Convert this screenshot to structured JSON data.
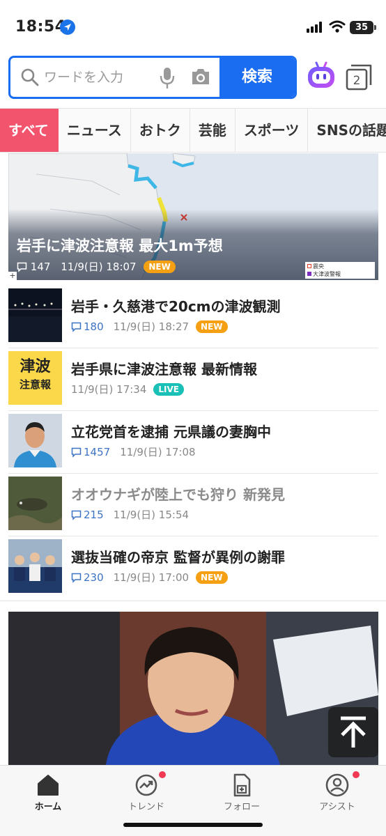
{
  "status": {
    "time": "18:54",
    "battery": "35"
  },
  "search": {
    "placeholder": "ワードを入力",
    "button": "検索"
  },
  "header": {
    "tab_count": "2"
  },
  "categories": [
    "すべて",
    "ニュース",
    "おトク",
    "芸能",
    "スポーツ",
    "SNSの話題"
  ],
  "hero": {
    "title": "岩手に津波注意報 最大1m予想",
    "comments": "147",
    "time": "11/9(日) 18:07",
    "badge": "NEW",
    "legend": [
      "震央",
      "大津波警報"
    ]
  },
  "thumb_labels": {
    "tsunami_line1": "津波",
    "tsunami_line2": "注意報"
  },
  "articles": [
    {
      "title": "岩手・久慈港で20cmの津波観測",
      "comments": "180",
      "time": "11/9(日) 18:27",
      "badge": "NEW"
    },
    {
      "title": "岩手県に津波注意報 最新情報",
      "time": "11/9(日) 17:34",
      "badge": "LIVE"
    },
    {
      "title": "立花党首を逮捕 元県議の妻胸中",
      "comments": "1457",
      "time": "11/9(日) 17:08"
    },
    {
      "title": "オオウナギが陸上でも狩り 新発見",
      "comments": "215",
      "time": "11/9(日) 15:54"
    },
    {
      "title": "選抜当確の帝京 監督が異例の謝罪",
      "comments": "230",
      "time": "11/9(日) 17:00",
      "badge": "NEW"
    }
  ],
  "nav": {
    "home": "ホーム",
    "trend": "トレンド",
    "follow": "フォロー",
    "assist": "アシスト"
  },
  "colors": {
    "accent": "#1a6cf0",
    "active_tab": "#f2546d",
    "new_badge": "#f4a012",
    "live_badge": "#19c0b5",
    "notify_dot": "#f03a55"
  }
}
